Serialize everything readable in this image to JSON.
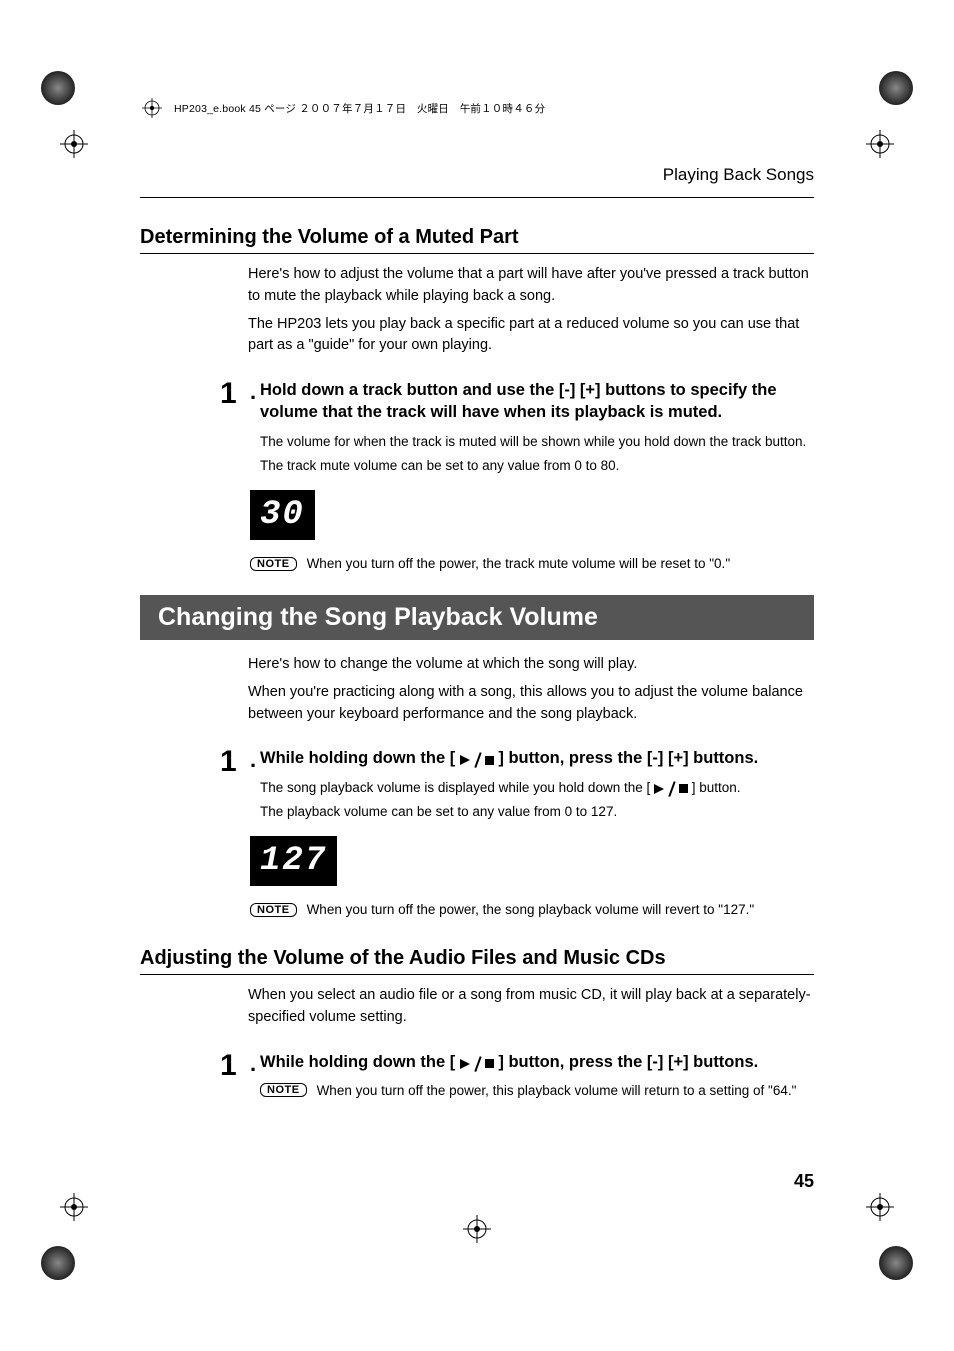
{
  "file_header": "HP203_e.book  45 ページ  ２００７年７月１７日　火曜日　午前１０時４６分",
  "chapter": "Playing Back Songs",
  "page_number": "45",
  "sec1": {
    "heading": "Determining the Volume of a Muted Part",
    "p1": "Here's how to adjust the volume that a part will have after you've pressed a track button to mute the playback while playing back a song.",
    "p2": "The HP203 lets you play back a specific part at a reduced volume so you can use that part as a \"guide\" for your own playing.",
    "step1_head": "Hold down a track button and use the [-] [+] buttons to specify the volume that the track will have when its playback is muted.",
    "step1_p1": "The volume for when the track is muted will be shown while you hold down the track button.",
    "step1_p2": "The track mute volume can be set to any value from 0 to 80.",
    "display": "30",
    "note": "When you turn off the power, the track mute volume will be reset to \"0.\""
  },
  "band": "Changing the Song Playback Volume",
  "sec2": {
    "p1": "Here's how to change the volume at which the song will play.",
    "p2": "When you're practicing along with a song, this allows you to adjust the volume balance between your keyboard performance and the song playback.",
    "step1_head_a": "While holding down the [ ",
    "step1_head_b": " ] button, press the [-] [+] buttons.",
    "step1_p1a": "The song playback volume is displayed while you hold down the [ ",
    "step1_p1b": " ] button.",
    "step1_p2": "The playback volume can be set to any value from 0 to 127.",
    "display": "127",
    "note": "When you turn off the power, the song playback volume will revert to \"127.\""
  },
  "sec3": {
    "heading": "Adjusting the Volume of the Audio Files and Music CDs",
    "p1": "When you select an audio file or a song from music CD, it will play back at a separately-specified volume setting.",
    "step1_head_a": "While holding down the [ ",
    "step1_head_b": " ] button, press the [-] [+] buttons.",
    "note": "When you turn off the power, this playback volume will return to a setting of \"64.\""
  },
  "labels": {
    "note": "NOTE",
    "step1": "1",
    "dot": "."
  }
}
